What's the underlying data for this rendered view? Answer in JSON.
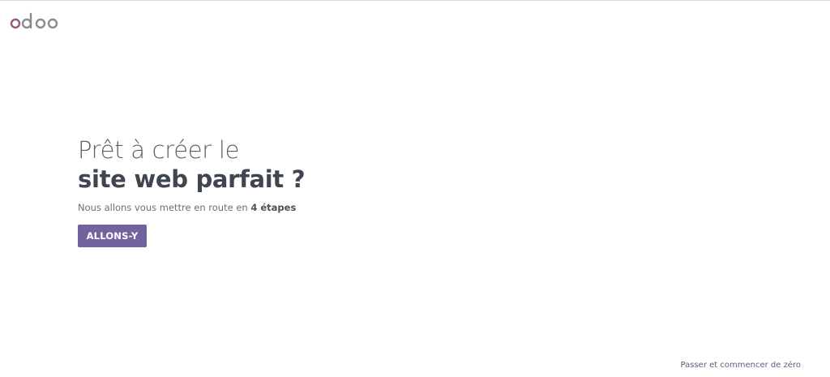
{
  "brand": {
    "name": "odoo",
    "color_primary": "#8f5b84",
    "color_secondary": "#8c8c8c"
  },
  "hero": {
    "title_line1": "Prêt à créer le",
    "title_line2": "site web parfait ?",
    "subtitle_prefix": "Nous allons vous mettre en route en ",
    "subtitle_emphasis": "4 étapes",
    "cta_label": "ALLONS-Y",
    "cta_color": "#71639e"
  },
  "footer": {
    "skip_label": "Passer et commencer de zéro"
  }
}
